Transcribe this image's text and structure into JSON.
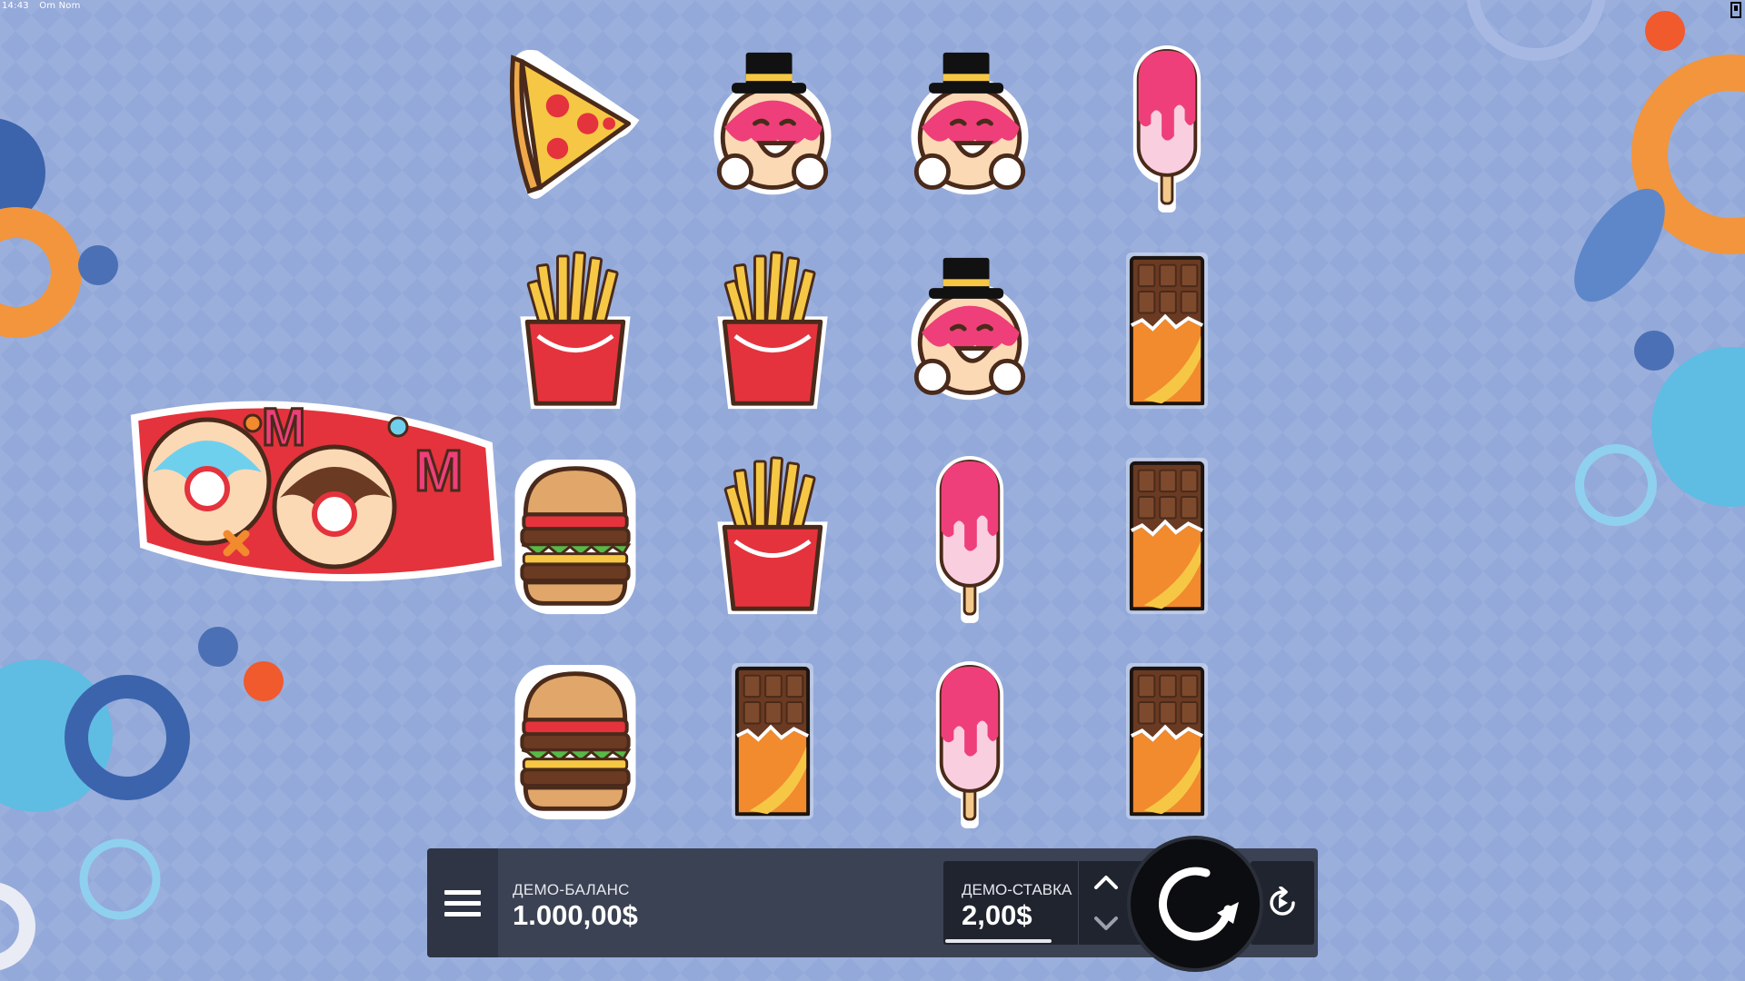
{
  "status_bar": {
    "time": "14:43",
    "window_title": "Om Nom"
  },
  "game": {
    "logo_text": "Om Nom"
  },
  "reels": {
    "columns": 4,
    "rows": 4,
    "grid": [
      [
        "pizza",
        "donut-gentleman",
        "donut-gentleman",
        "popsicle"
      ],
      [
        "fries",
        "fries",
        "donut-gentleman",
        "chocolate-bar"
      ],
      [
        "burger",
        "fries",
        "popsicle",
        "chocolate-bar"
      ],
      [
        "burger",
        "chocolate-bar",
        "popsicle",
        "chocolate-bar"
      ]
    ]
  },
  "controls": {
    "balance_label": "ДЕМО-БАЛАНС",
    "balance_value": "1.000,00$",
    "stake_label": "ДЕМО-СТАВКА",
    "stake_value": "2,00$",
    "stake_level": 0.78,
    "menu_icon": "hamburger-menu-icon",
    "spin_icon": "spin-arrow-icon",
    "autoplay_icon": "autoplay-icon"
  },
  "colors": {
    "background": "#93a9d9",
    "control_bar": "#3b4253",
    "accent_orange": "#f28a2e",
    "accent_pink": "#ee3f7a"
  }
}
